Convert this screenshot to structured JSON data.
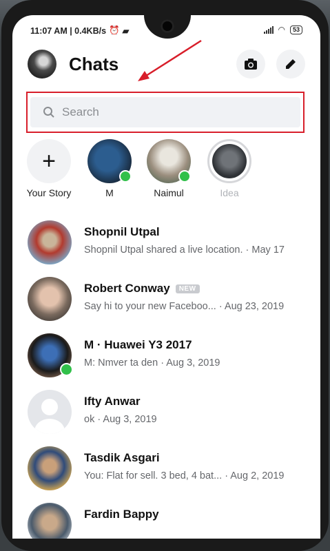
{
  "status_bar": {
    "left": "11:07 AM | 0.4KB/s",
    "battery": "53"
  },
  "header": {
    "title": "Chats"
  },
  "search": {
    "placeholder": "Search"
  },
  "stories": [
    {
      "label": "Your Story"
    },
    {
      "label": "M"
    },
    {
      "label": "Naimul"
    },
    {
      "label": "Idea"
    }
  ],
  "chats": [
    {
      "name": "Shopnil Utpal",
      "preview": "Shopnil Utpal shared a live location. · May 17"
    },
    {
      "name": "Robert Conway",
      "badge": "NEW",
      "preview": "Say hi to your new Faceboo... · Aug 23, 2019"
    },
    {
      "name": "M · Huawei Y3 2017",
      "preview": "M: Nmver ta den · Aug 3, 2019"
    },
    {
      "name": "Ifty Anwar",
      "preview": "ok · Aug 3, 2019"
    },
    {
      "name": "Tasdik Asgari",
      "preview": "You: Flat for sell. 3 bed, 4 bat... · Aug 2, 2019"
    },
    {
      "name": "Fardin Bappy",
      "preview": ""
    }
  ],
  "colors": {
    "highlight": "#d81e2a",
    "online": "#31c04a"
  }
}
